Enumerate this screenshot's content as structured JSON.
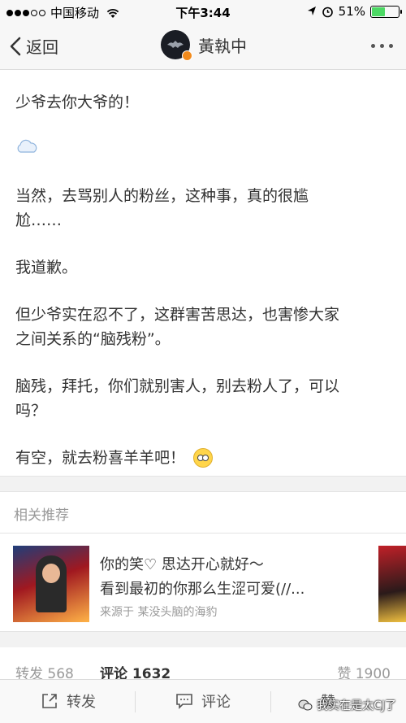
{
  "status_bar": {
    "carrier": "中国移动",
    "time": "下午3:44",
    "battery": "51%",
    "battery_level": 0.51
  },
  "nav": {
    "back_label": "返回",
    "title": "黃執中"
  },
  "post": {
    "paragraphs": [
      "少爷去你大爷的！",
      "当然，去骂别人的粉丝，这种事，真的很尴尬……",
      "我道歉。",
      "但少爷实在忍不了，这群害苦思达，也害惨大家之间关系的“脑残粉”。",
      "脑残，拜托，你们就别害人，别去粉人了，可以吗？",
      "有空，就去粉喜羊羊吧！"
    ],
    "p2_line1": "当然，去骂别人的粉丝，这种事，真的很尴",
    "p2_line2": "尬……",
    "p4_line1": "但少爷实在忍不了，这群害苦思达，也害惨大家",
    "p4_line2": "之间关系的“脑残粉”。",
    "p5_line1": "脑残，拜托，你们就别害人，别去粉人了，可以",
    "p5_line2": "吗？"
  },
  "related": {
    "header": "相关推荐",
    "card": {
      "line1": "你的笑♡ 思达开心就好～",
      "line2": "看到最初的你那么生涩可爱(//...",
      "source": "来源于 某没头脑的海豹"
    }
  },
  "stats": {
    "repost": "转发 568",
    "comment": "评论 1632",
    "like": "赞 1900"
  },
  "bottom_bar": {
    "repost": "转发",
    "comment": "评论",
    "like": "赞"
  },
  "watermark": "我实在是太CJ了"
}
